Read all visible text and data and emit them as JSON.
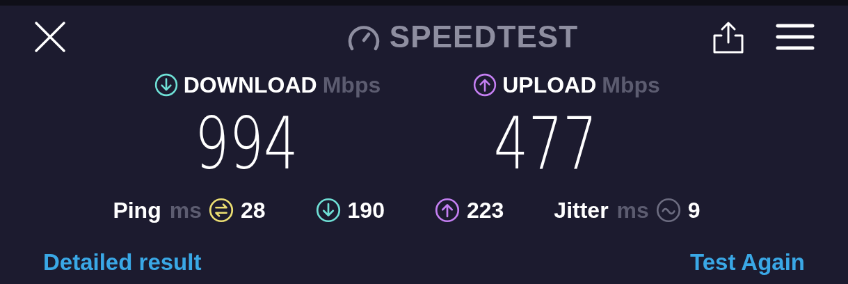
{
  "title": "SPEEDTEST",
  "results": [
    {
      "kind": "download",
      "label": "DOWNLOAD",
      "unit": "Mbps",
      "value": "994"
    },
    {
      "kind": "upload",
      "label": "UPLOAD",
      "unit": "Mbps",
      "value": "477"
    }
  ],
  "stats": [
    {
      "kind": "ping",
      "label": "Ping",
      "unit": "ms",
      "value": "28"
    },
    {
      "kind": "download",
      "value": "190"
    },
    {
      "kind": "upload",
      "value": "223"
    },
    {
      "kind": "jitter",
      "label": "Jitter",
      "unit": "ms",
      "value": "9"
    }
  ],
  "links": [
    "Detailed result",
    "Test Again"
  ]
}
